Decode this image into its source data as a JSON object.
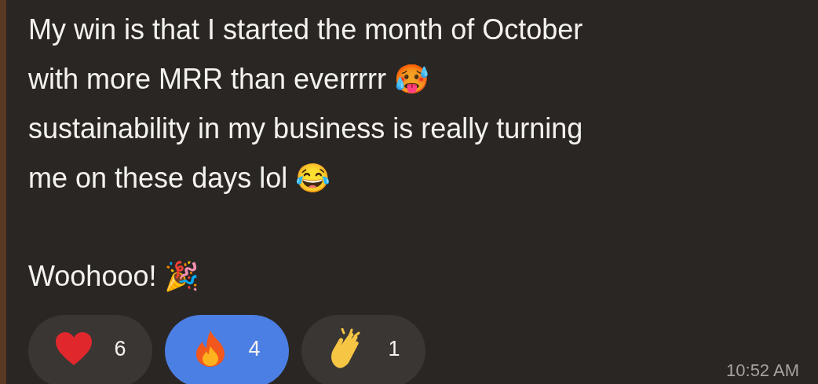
{
  "message": {
    "paragraphs": [
      "My win is that I started the month of October\nwith more MRR than everrrrr 🥵\nsustainability in my business is really turning\nme on these days lol 😂",
      "Woohooo! 🎉"
    ],
    "reactions": [
      {
        "kind": "heart",
        "count": "6",
        "selected": false
      },
      {
        "kind": "fire",
        "count": "4",
        "selected": true
      },
      {
        "kind": "clap",
        "count": "1",
        "selected": false
      }
    ],
    "time": "10:52 AM"
  }
}
